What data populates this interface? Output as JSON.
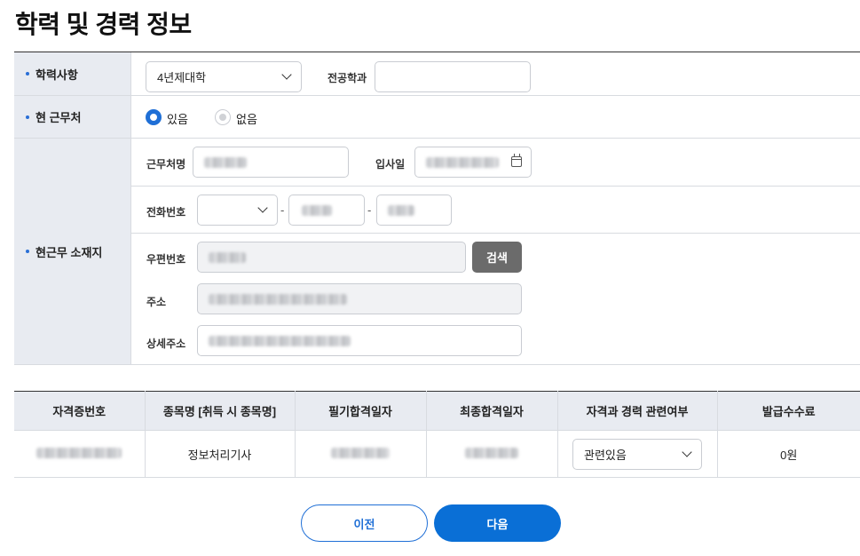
{
  "title": "학력 및 경력 정보",
  "education": {
    "label": "학력사항",
    "degree_value": "4년제대학",
    "major_label": "전공학과",
    "major_value": ""
  },
  "current_job": {
    "label": "현 근무처",
    "options": [
      "있음",
      "없음"
    ],
    "selected": "있음"
  },
  "location": {
    "label": "현근무 소재지",
    "company_label": "근무처명",
    "join_date_label": "입사일",
    "phone_label": "전화번호",
    "postal_label": "우편번호",
    "search_button": "검색",
    "address_label": "주소",
    "detail_address_label": "상세주소",
    "dash": "-"
  },
  "certificates": {
    "columns": [
      "자격증번호",
      "종목명 [취득 시 종목명]",
      "필기합격일자",
      "최종합격일자",
      "자격과 경력 관련여부",
      "발급수수료"
    ],
    "rows": [
      {
        "cert_name": "정보처리기사",
        "relation": "관련있음",
        "fee": "0원"
      }
    ]
  },
  "buttons": {
    "prev": "이전",
    "next": "다음"
  },
  "colors": {
    "accent": "#0a6fd6",
    "label_bg": "#e8ebf1",
    "search_button_bg": "#6b6b6b"
  }
}
